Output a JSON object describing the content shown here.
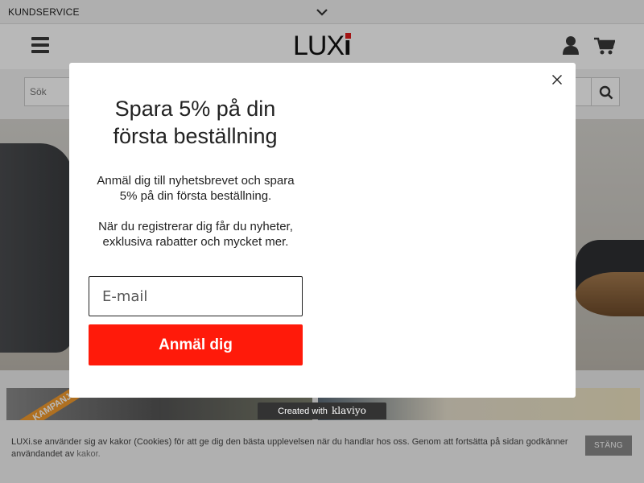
{
  "topbar": {
    "customer_service": "KUNDSERVICE"
  },
  "header": {
    "logo_text": "LUX",
    "logo_accent": "i"
  },
  "search": {
    "placeholder": "Sök"
  },
  "banner": {
    "tag": "KAMPANJ"
  },
  "popup": {
    "title": "Spara 5% på din första beställning",
    "description_1": "Anmäl dig till nyhetsbrevet och spara 5% på din första beställning.",
    "description_2": "När du registrerar dig får du nyheter, exklusiva rabatter och mycket mer.",
    "email_placeholder": "E-mail",
    "submit_label": "Anmäl dig"
  },
  "klaviyo": {
    "created_with": "Created with",
    "brand": "klaviyo"
  },
  "cookie": {
    "text": "LUXi.se använder sig av kakor (Cookies) för att ge dig den bästa upplevelsen när du handlar hos oss. Genom att fortsätta på sidan godkänner användandet av",
    "link": "kakor.",
    "button": "STÄNG"
  },
  "colors": {
    "accent_red": "#ff1a0a",
    "banner_tag": "#f39b2e"
  },
  "icons": [
    "chevron-down-icon",
    "menu-icon",
    "user-icon",
    "cart-icon",
    "search-icon",
    "close-icon"
  ]
}
